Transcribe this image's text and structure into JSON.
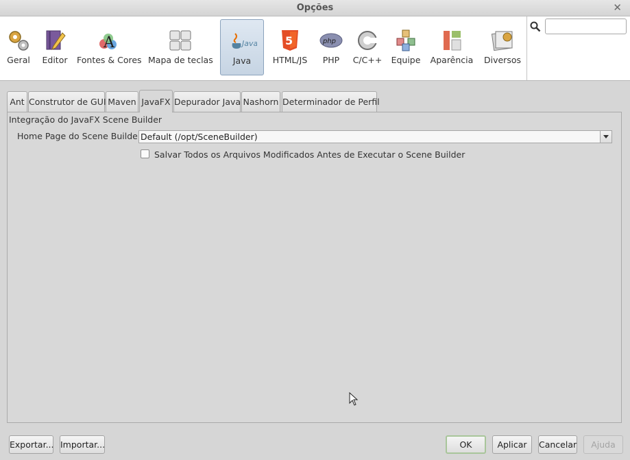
{
  "window": {
    "title": "Opções",
    "close_glyph": "✕"
  },
  "categories": [
    {
      "label": "Geral",
      "icon": "gears-icon"
    },
    {
      "label": "Editor",
      "icon": "pencil-book-icon"
    },
    {
      "label": "Fontes & Cores",
      "icon": "font-palette-icon"
    },
    {
      "label": "Mapa de teclas",
      "icon": "keyboard-icon"
    },
    {
      "label": "Java",
      "icon": "java-cup-icon",
      "selected": true
    },
    {
      "label": "HTML/JS",
      "icon": "html5-icon"
    },
    {
      "label": "PHP",
      "icon": "php-icon"
    },
    {
      "label": "C/C++",
      "icon": "c-plus-plus-icon"
    },
    {
      "label": "Equipe",
      "icon": "team-cubes-icon"
    },
    {
      "label": "Aparência",
      "icon": "appearance-icon"
    },
    {
      "label": "Diversos",
      "icon": "misc-folders-icon"
    }
  ],
  "search": {
    "value": "",
    "placeholder": ""
  },
  "tabs": [
    {
      "label": "Ant"
    },
    {
      "label": "Construtor de GUI"
    },
    {
      "label": "Maven"
    },
    {
      "label": "JavaFX",
      "active": true
    },
    {
      "label": "Depurador Java"
    },
    {
      "label": "Nashorn"
    },
    {
      "label": "Determinador de Perfil"
    }
  ],
  "panel": {
    "group_title": "Integração do JavaFX Scene Builder",
    "home_page_label": "Home Page do Scene Builder:",
    "home_page_value": "Default (/opt/SceneBuilder)",
    "save_all_label": "Salvar Todos os Arquivos Modificados Antes de Executar o Scene Builder",
    "save_all_checked": false
  },
  "buttons": {
    "export": "Exportar...",
    "import": "Importar...",
    "ok": "OK",
    "apply": "Aplicar",
    "cancel": "Cancelar",
    "help": "Ajuda"
  },
  "colors": {
    "selected_category_bg": "#c6d4e3",
    "ok_border": "#a8c59a",
    "html5_orange": "#e44d26",
    "java_blue": "#5382a1",
    "java_orange": "#e76f00"
  }
}
